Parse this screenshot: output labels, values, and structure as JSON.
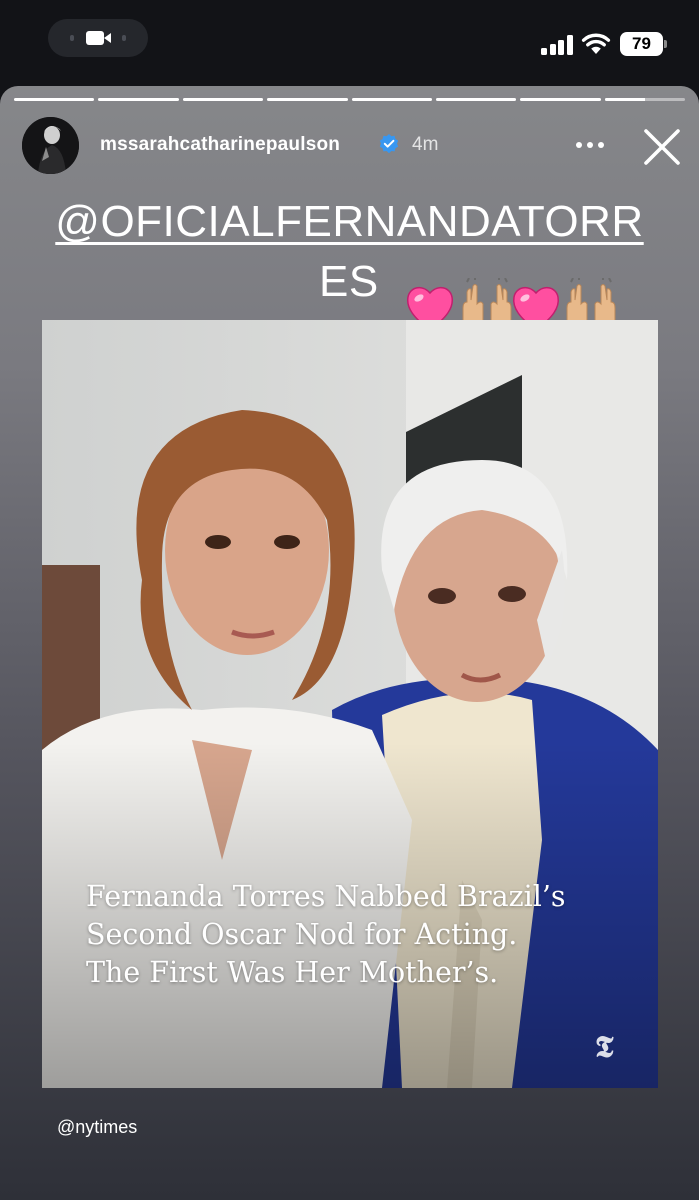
{
  "status_bar": {
    "battery": "79",
    "icons": [
      "video-camera-icon",
      "cellular-signal-icon",
      "wifi-icon",
      "battery-icon"
    ]
  },
  "story": {
    "progress_segments": 8,
    "progress_filled": [
      1,
      1,
      1,
      1,
      1,
      1,
      1,
      0.5
    ],
    "username": "mssarahcatharinepaulson",
    "time": "4m",
    "mention_line1": "@OFICIALFERNANDATORR",
    "mention_line2": "ES",
    "emojis": [
      "pink-heart",
      "raising-hands",
      "pink-heart",
      "raising-hands"
    ],
    "headline_lines": [
      "Fernanda Torres Nabbed Brazil’s",
      "Second Oscar Nod for Acting.",
      "The First Was Her Mother’s."
    ],
    "source": "@nytimes",
    "colors": {
      "verified": "#3897f0",
      "heart": "#ff4fa0",
      "hands": "#e8b98a"
    }
  }
}
